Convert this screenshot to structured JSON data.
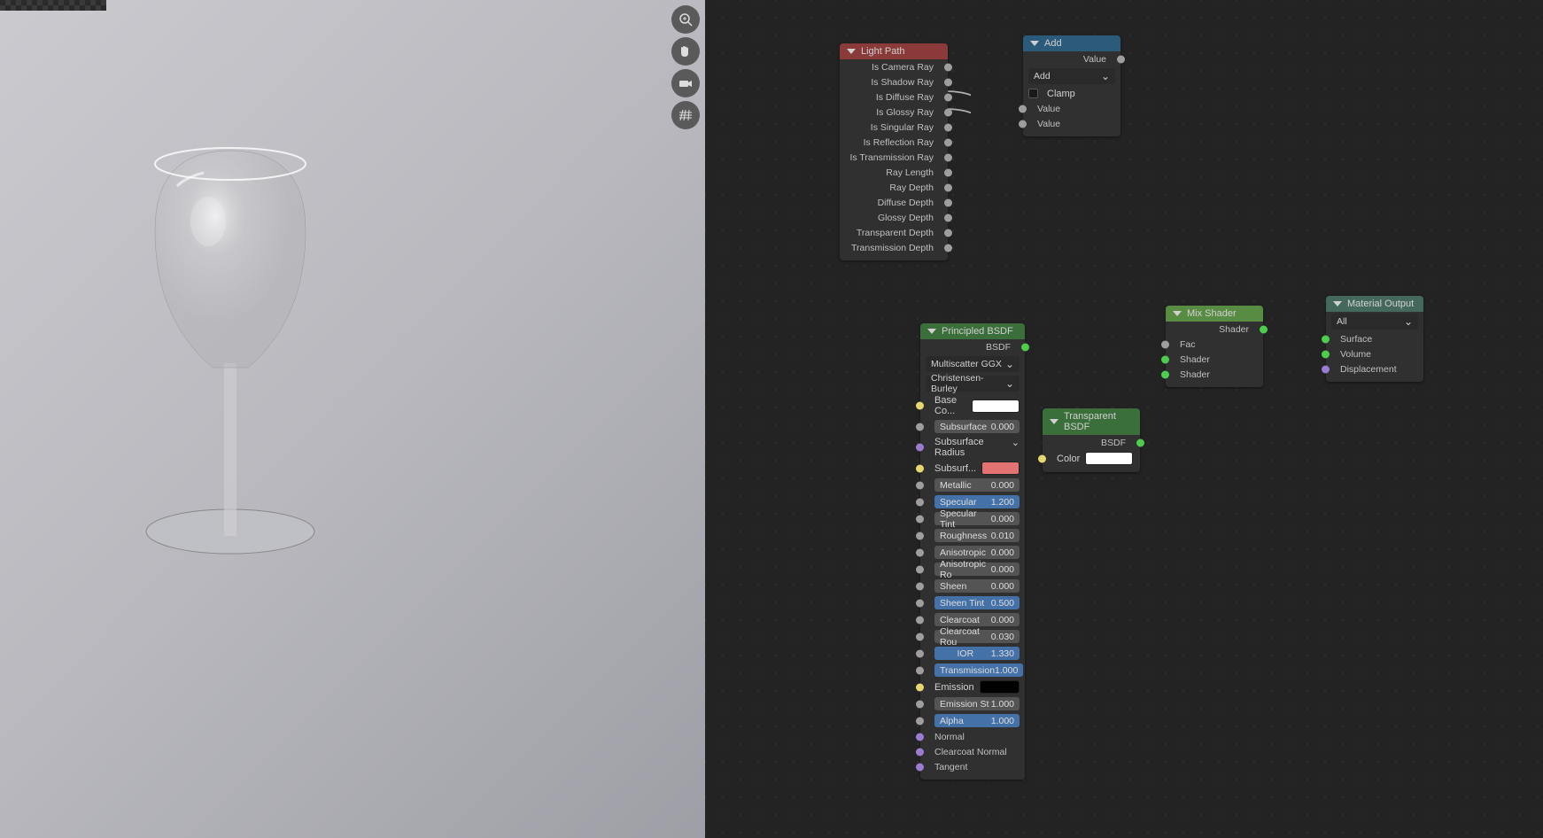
{
  "tools": {
    "magnify": "magnify-icon",
    "hand": "hand-icon",
    "camera": "camera-icon",
    "grid": "grid-icon"
  },
  "lightpath": {
    "title": "Light Path",
    "outputs": [
      "Is Camera Ray",
      "Is Shadow Ray",
      "Is Diffuse Ray",
      "Is Glossy Ray",
      "Is Singular Ray",
      "Is Reflection Ray",
      "Is Transmission Ray",
      "Ray Length",
      "Ray Depth",
      "Diffuse Depth",
      "Glossy Depth",
      "Transparent Depth",
      "Transmission Depth"
    ]
  },
  "add": {
    "title": "Add",
    "out": "Value",
    "mode": "Add",
    "clamp": "Clamp",
    "in1": "Value",
    "in2": "Value"
  },
  "mix": {
    "title": "Mix Shader",
    "out": "Shader",
    "fac": "Fac",
    "s1": "Shader",
    "s2": "Shader"
  },
  "matout": {
    "title": "Material Output",
    "mode": "All",
    "surf": "Surface",
    "vol": "Volume",
    "disp": "Displacement"
  },
  "tbsdf": {
    "title": "Transparent BSDF",
    "out": "BSDF",
    "color": "Color"
  },
  "pbsdf": {
    "title": "Principled BSDF",
    "out": "BSDF",
    "dist": "Multiscatter GGX",
    "sss": "Christensen-Burley",
    "basecolor": "Base Co...",
    "subsurface": {
      "l": "Subsurface",
      "v": "0.000"
    },
    "sssradius": "Subsurface Radius",
    "ssscolor": "Subsurf...",
    "metallic": {
      "l": "Metallic",
      "v": "0.000"
    },
    "specular": {
      "l": "Specular",
      "v": "1.200"
    },
    "spectint": {
      "l": "Specular Tint",
      "v": "0.000"
    },
    "rough": {
      "l": "Roughness",
      "v": "0.010"
    },
    "aniso": {
      "l": "Anisotropic",
      "v": "0.000"
    },
    "anisorot": {
      "l": "Anisotropic Ro",
      "v": "0.000"
    },
    "sheen": {
      "l": "Sheen",
      "v": "0.000"
    },
    "sheentint": {
      "l": "Sheen Tint",
      "v": "0.500"
    },
    "clearcoat": {
      "l": "Clearcoat",
      "v": "0.000"
    },
    "clearcoatrough": {
      "l": "Clearcoat Rou",
      "v": "0.030"
    },
    "ior": {
      "l": "IOR",
      "v": "1.330"
    },
    "transmission": {
      "l": "Transmission",
      "v": "1.000"
    },
    "emission": "Emission",
    "emissionstr": {
      "l": "Emission St",
      "v": "1.000"
    },
    "alpha": {
      "l": "Alpha",
      "v": "1.000"
    },
    "normal": "Normal",
    "clearcoatnormal": "Clearcoat Normal",
    "tangent": "Tangent"
  }
}
